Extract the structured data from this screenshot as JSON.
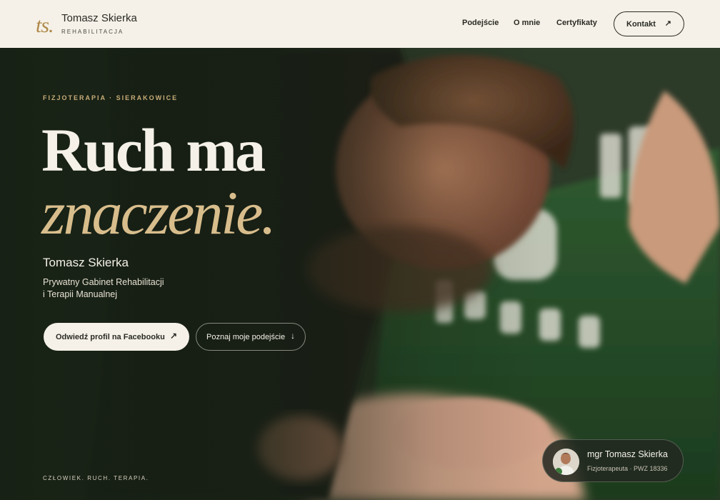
{
  "header": {
    "logo": "ts.",
    "brand_name": "Tomasz Skierka",
    "brand_sub": "REHABILITACJA",
    "nav": [
      "Podejście",
      "O mnie",
      "Certyfikaty"
    ],
    "contact_label": "Kontakt",
    "contact_arrow": "↗"
  },
  "hero": {
    "eyebrow": "FIZJOTERAPIA · SIERAKOWICE",
    "headline_line1": "Ruch ma",
    "headline_line2": "znaczenie.",
    "name": "Tomasz Skierka",
    "description_line1": "Prywatny Gabinet Rehabilitacji",
    "description_line2": "i Terapii Manualnej",
    "btn_facebook": "Odwiedź profil na Facebooku",
    "btn_facebook_arrow": "↗",
    "btn_approach": "Poznaj moje podejście",
    "btn_approach_arrow": "↓",
    "tagline": "CZŁOWIEK. RUCH. TERAPIA."
  },
  "card": {
    "name": "mgr Tomasz Skierka",
    "title": "Fizjoterapeuta · PWZ 18336"
  },
  "colors": {
    "accent_gold": "#c9ad78",
    "headline_gold": "#d8bd8c",
    "dark_green": "#1f2a1d",
    "cream": "#f5f1e8"
  }
}
